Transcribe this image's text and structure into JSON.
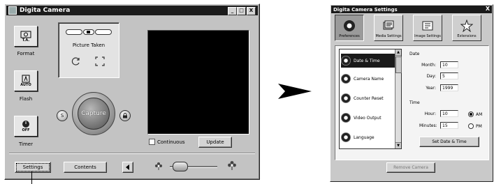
{
  "camera_window": {
    "title": "Digita Camera",
    "title_buttons": [
      "_",
      "□",
      "X"
    ],
    "tools": [
      {
        "icon_text": "T.A.",
        "label": "Format"
      },
      {
        "icon_text": "AUTO",
        "label": "Flash"
      },
      {
        "icon_text": "OFF",
        "label": "Timer"
      }
    ],
    "status_label": "Picture Taken",
    "capture_label": "Capture",
    "left_round_label": "S",
    "right_round_label": "",
    "continuous_label": "Continuous",
    "update_label": "Update",
    "settings_label": "Settings",
    "contents_label": "Contents"
  },
  "settings_window": {
    "title": "Digita Camera Settings",
    "close_glyph": "X",
    "tabs": [
      {
        "label": "Preferences",
        "active": true
      },
      {
        "label": "Media Settings",
        "active": false
      },
      {
        "label": "Image Settings",
        "active": false
      },
      {
        "label": "Extensions",
        "active": false
      }
    ],
    "list_items": [
      {
        "label": "Date & Time",
        "selected": true
      },
      {
        "label": "Camera Name",
        "selected": false
      },
      {
        "label": "Counter Reset",
        "selected": false
      },
      {
        "label": "Video Output",
        "selected": false
      },
      {
        "label": "Language",
        "selected": false
      }
    ],
    "date_group": "Date",
    "month_label": "Month:",
    "month_value": "10",
    "day_label": "Day:",
    "day_value": "5",
    "year_label": "Year:",
    "year_value": "1999",
    "time_group": "Time",
    "hour_label": "Hour:",
    "hour_value": "10",
    "minutes_label": "Minutes:",
    "minutes_value": "15",
    "am_label": "AM",
    "pm_label": "PM",
    "set_button": "Set Date & Time",
    "bottom_button": "Remove Camera"
  },
  "colors": {
    "titlebar": "#1c1c1c",
    "window_face": "#c3c3c3",
    "preview": "#000000"
  }
}
